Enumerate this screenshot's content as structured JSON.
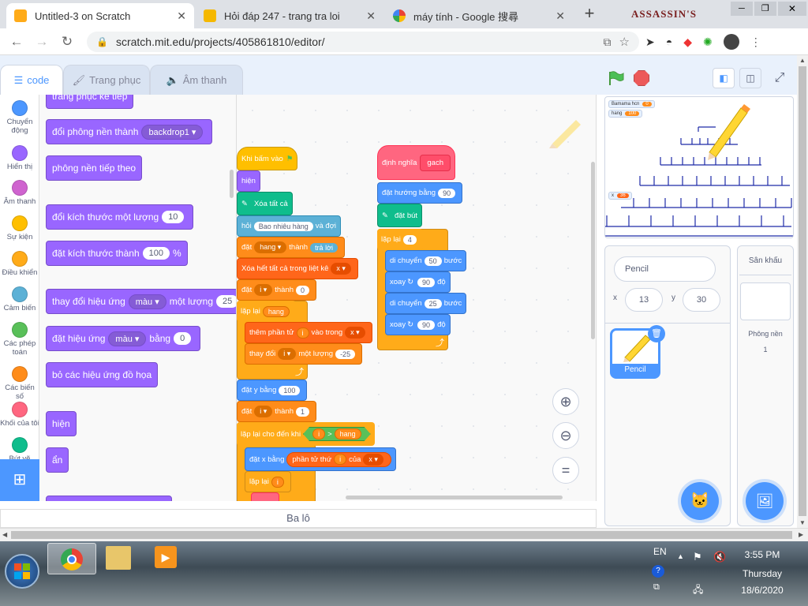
{
  "browser": {
    "tabs": [
      {
        "title": "Untitled-3 on Scratch",
        "icon": "scratch-favicon"
      },
      {
        "title": "Hỏi đáp 247 - trang tra loi",
        "icon": "hoidap-favicon"
      },
      {
        "title": "máy tính - Google 搜尋",
        "icon": "google-favicon"
      }
    ],
    "new_tab": "+",
    "url": "scratch.mit.edu/projects/405861810/editor/",
    "window_title": "ASSASSIN'S CREED III"
  },
  "editor": {
    "tabs": [
      {
        "label": "code"
      },
      {
        "label": "Trang phục"
      },
      {
        "label": "Âm thanh"
      }
    ],
    "categories": [
      {
        "label": "Chuyển động",
        "color": "#4c97ff"
      },
      {
        "label": "Hiển thị",
        "color": "#9966ff"
      },
      {
        "label": "Âm thanh",
        "color": "#cf63cf"
      },
      {
        "label": "Sự kiện",
        "color": "#ffbf00"
      },
      {
        "label": "Điều khiển",
        "color": "#ffab19"
      },
      {
        "label": "Cảm biến",
        "color": "#5cb1d6"
      },
      {
        "label": "Các phép toán",
        "color": "#59c059"
      },
      {
        "label": "Các biến số",
        "color": "#ff8c1a"
      },
      {
        "label": "Khối của tôi",
        "color": "#ff6680"
      },
      {
        "label": "Bút vẽ",
        "color": "#0fbd8c"
      }
    ],
    "palette": {
      "b0": "trang phục kế tiếp",
      "b1": {
        "text": "đổi phông nền thành",
        "dd": "backdrop1"
      },
      "b2": "phông nền tiếp theo",
      "b3": {
        "text": "đổi kích thước một lượng",
        "val": "10"
      },
      "b4": {
        "text": "đặt kích thước thành",
        "val": "100",
        "unit": "%"
      },
      "b5": {
        "text": "thay đổi hiệu ứng",
        "dd": "màu",
        "mid": "một lượng",
        "val": "25"
      },
      "b6": {
        "text": "đặt hiệu ứng",
        "dd": "màu",
        "mid": "bằng",
        "val": "0"
      },
      "b7": "bỏ các hiệu ứng đồ họa",
      "b8": "hiện",
      "b9": "ẩn"
    },
    "script1": {
      "hat": "Khi bấm vào",
      "show": "hiện",
      "clear": "Xóa tất cả",
      "ask": {
        "text": "hỏi",
        "val": "Bao nhiêu hàng",
        "tail": "và đợi"
      },
      "set_hang": {
        "text": "đặt",
        "var": "hang",
        "mid": "thành",
        "val": "trả lời"
      },
      "delete_all": {
        "text": "Xóa hết tất cả trong liệt kê",
        "list": "x"
      },
      "set_i": {
        "text": "đặt",
        "var": "i",
        "mid": "thành",
        "val": "0"
      },
      "repeat": {
        "text": "lặp lại",
        "val": "hang"
      },
      "insert": {
        "text": "thêm phần tử",
        "val": "i",
        "mid": "vào trong",
        "list": "x"
      },
      "change_i": {
        "text": "thay đổi",
        "var": "i",
        "mid": "một lượng",
        "val": "-25"
      },
      "set_y": {
        "text": "đặt y bằng",
        "val": "100"
      },
      "set_i2": {
        "text": "đặt",
        "var": "i",
        "mid": "thành",
        "val": "1"
      },
      "repeat_until": {
        "text": "lặp lại cho đến khi",
        "a": "i",
        "op": ">",
        "b": "hang"
      },
      "set_x": {
        "text": "đặt x bằng",
        "item": "phần tử thứ",
        "idx": "i",
        "of": "của",
        "list": "x"
      },
      "repeat_i": {
        "text": "lặp lại",
        "val": "i"
      }
    },
    "script2": {
      "define": {
        "text": "định nghĩa",
        "name": "gach"
      },
      "point": {
        "text": "đặt hướng bằng",
        "val": "90"
      },
      "pendown": "đặt bút",
      "repeat": {
        "text": "lặp lại",
        "val": "4"
      },
      "move1": {
        "text": "di chuyển",
        "val": "50",
        "unit": "bước"
      },
      "turn1": {
        "text": "xoay",
        "val": "90",
        "unit": "độ"
      },
      "move2": {
        "text": "di chuyển",
        "val": "25",
        "unit": "bước"
      },
      "turn2": {
        "text": "xoay",
        "val": "90",
        "unit": "độ"
      }
    },
    "zoom": {
      "in": "+",
      "out": "−",
      "reset": "="
    },
    "backpack": "Ba lô"
  },
  "stage": {
    "monitors": [
      {
        "label": "Bamama hcn",
        "value": "0"
      },
      {
        "label": "hang",
        "value": "100"
      },
      {
        "label": "x",
        "value": "36"
      }
    ]
  },
  "sprite_info": {
    "name": "Pencil",
    "x_label": "x",
    "x": "13",
    "y_label": "y",
    "y": "30",
    "thumb_label": "Pencil"
  },
  "stage_panel": {
    "title": "Sân khấu",
    "backdrops_label": "Phông nền",
    "backdrops_count": "1"
  },
  "taskbar": {
    "lang": "EN",
    "time": "3:55 PM",
    "day": "Thursday",
    "date": "18/6/2020"
  }
}
